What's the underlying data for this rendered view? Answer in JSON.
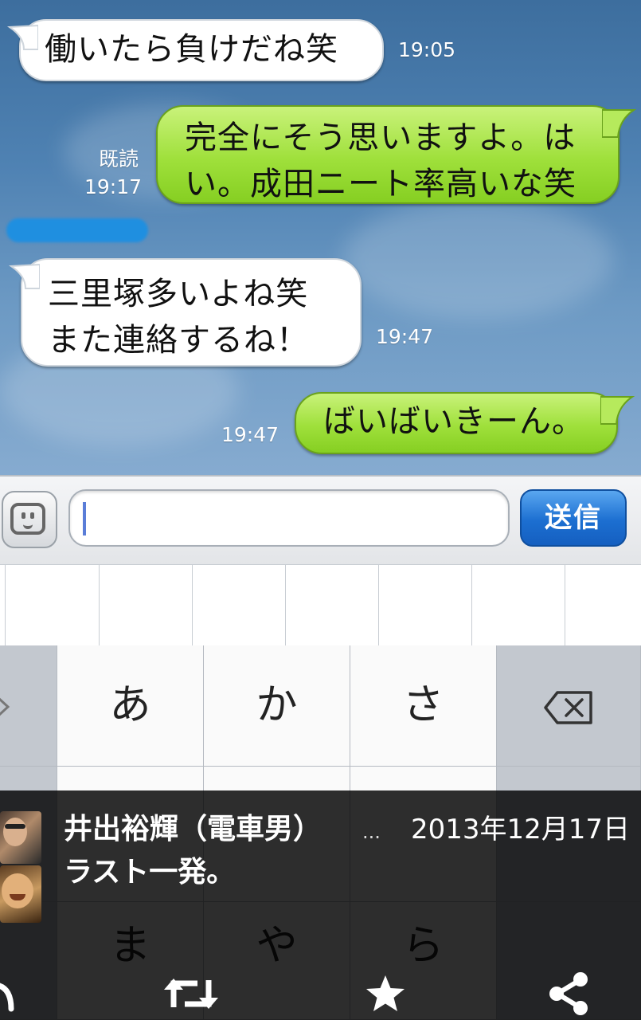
{
  "chat": {
    "messages": [
      {
        "side": "left",
        "text_lines": [
          "働いたら負けだね笑"
        ],
        "time": "19:05"
      },
      {
        "side": "right",
        "text_lines": [
          "完全にそう思いますよ。は",
          "い。成田ニート率高いな笑"
        ],
        "read_label": "既読",
        "time": "19:17"
      },
      {
        "side": "left",
        "text_lines": [
          "三里塚多いよね笑",
          "また連絡するね！"
        ],
        "time": "19:47"
      },
      {
        "side": "right",
        "text_lines": [
          "ばいばいきーん。"
        ],
        "time": "19:47"
      }
    ]
  },
  "input_bar": {
    "message_value": "",
    "send_label": "送信"
  },
  "keyboard": {
    "keys_row1": [
      "あ",
      "か",
      "さ"
    ],
    "keys_row3_ghost": [
      "ま",
      "や",
      "ら"
    ],
    "backspace_icon": "backspace-icon"
  },
  "overlay": {
    "author": "井出裕輝（電車男）",
    "ellipsis": "...",
    "date": "2013年12月17日",
    "text": "ラスト一発。",
    "actions": [
      "reply-icon",
      "retweet-icon",
      "star-icon",
      "share-icon"
    ]
  },
  "colors": {
    "chat_bg": "#4f82b3",
    "green_bubble": "#9fe03b",
    "send_button": "#1c6fd1",
    "redaction": "#1f8fe0"
  }
}
